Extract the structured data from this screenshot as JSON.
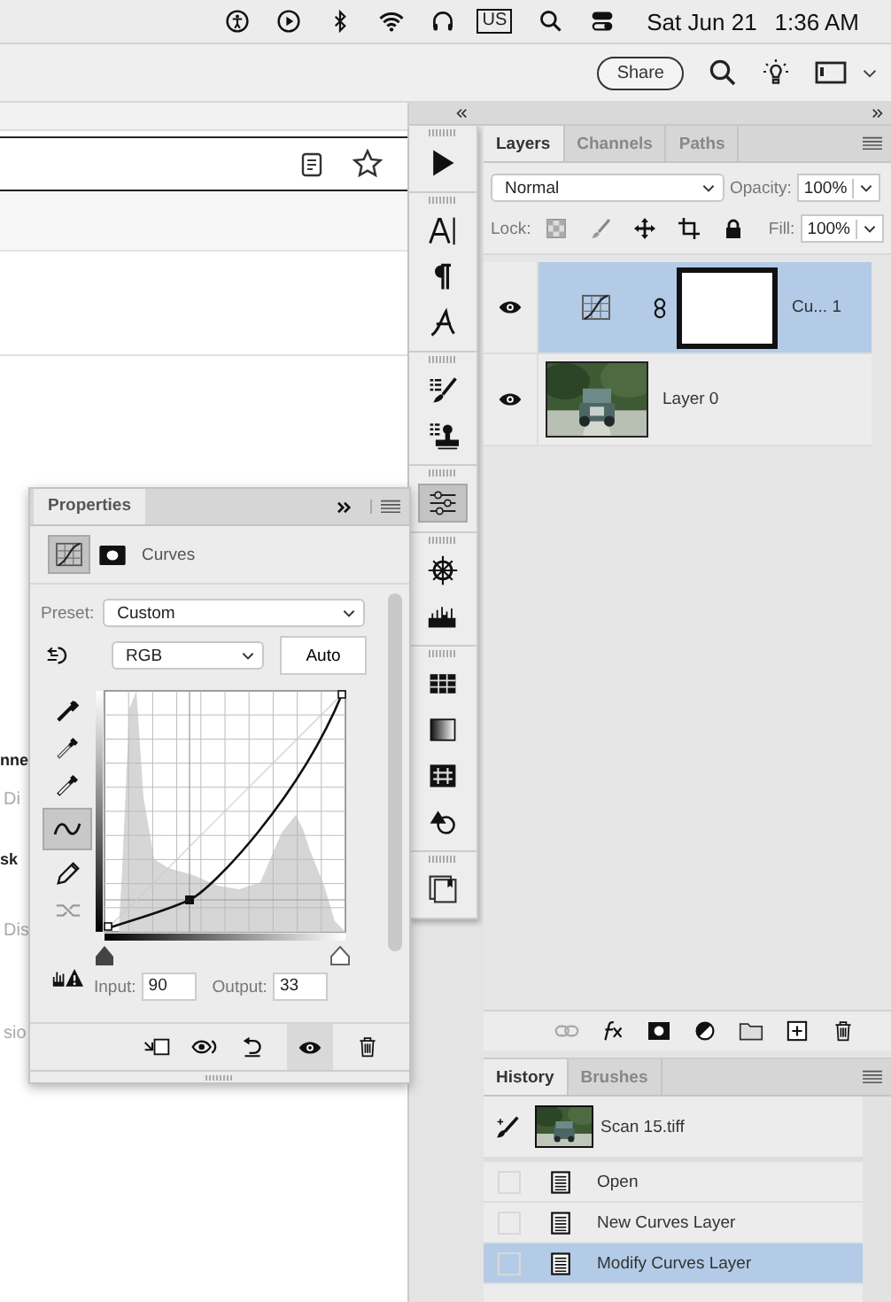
{
  "menu_bar": {
    "input_source": "US",
    "date": "Sat Jun 21",
    "time": "1:36 AM"
  },
  "browser": {
    "share_button": "Share",
    "page_fragments": [
      {
        "text": "nne",
        "kind": "heading"
      },
      {
        "text": "Di",
        "kind": "muted"
      },
      {
        "text": "sk",
        "kind": "heading"
      },
      {
        "text": "Dis",
        "kind": "muted"
      },
      {
        "text": "sio",
        "kind": "muted"
      }
    ]
  },
  "tool_groups": [
    {
      "tools": [
        {
          "kind": "play",
          "selected": false
        }
      ]
    },
    {
      "tools": [
        {
          "kind": "character",
          "selected": false
        },
        {
          "kind": "paragraph",
          "selected": false
        },
        {
          "kind": "glyphs",
          "selected": false
        }
      ]
    },
    {
      "tools": [
        {
          "kind": "brush-list",
          "selected": false
        },
        {
          "kind": "stamp-list",
          "selected": false
        }
      ]
    },
    {
      "tools": [
        {
          "kind": "adjustments",
          "selected": true
        }
      ]
    },
    {
      "tools": [
        {
          "kind": "navigator",
          "selected": false
        },
        {
          "kind": "histogram",
          "selected": false
        }
      ]
    },
    {
      "tools": [
        {
          "kind": "swatches",
          "selected": false
        },
        {
          "kind": "gradient",
          "selected": false
        },
        {
          "kind": "patterns",
          "selected": false
        },
        {
          "kind": "shapes",
          "selected": false
        }
      ]
    },
    {
      "tools": [
        {
          "kind": "libraries",
          "selected": false
        }
      ]
    }
  ],
  "layers_panel": {
    "tabs": [
      {
        "label": "Layers",
        "selected": true
      },
      {
        "label": "Channels",
        "selected": false
      },
      {
        "label": "Paths",
        "selected": false
      }
    ],
    "blend_mode": "Normal",
    "opacity_label": "Opacity:",
    "opacity": "100%",
    "lock_label": "Lock:",
    "fill_label": "Fill:",
    "fill": "100%",
    "layers": [
      {
        "name": "Cu... 1",
        "kind": "adjustment",
        "selected": true,
        "visible": true
      },
      {
        "name": "Layer 0",
        "selected": false,
        "visible": true
      }
    ]
  },
  "history_panel": {
    "tabs": [
      {
        "label": "History",
        "selected": true
      },
      {
        "label": "Brushes",
        "selected": false
      }
    ],
    "snapshot": "Scan 15.tiff",
    "states": [
      {
        "label": "Open",
        "selected": false
      },
      {
        "label": "New Curves Layer",
        "selected": false
      },
      {
        "label": "Modify Curves Layer",
        "selected": true
      }
    ]
  },
  "properties_panel": {
    "title": "Properties",
    "adjustment": "Curves",
    "preset_label": "Preset:",
    "preset": "Custom",
    "channel": "RGB",
    "auto_button": "Auto",
    "input_label": "Input:",
    "input": "90",
    "output_label": "Output:",
    "output": "33"
  }
}
